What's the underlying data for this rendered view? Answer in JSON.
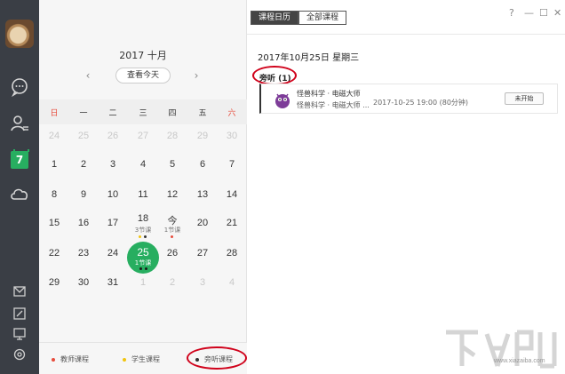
{
  "sidebar": {
    "icons": [
      "avatar",
      "chat-icon",
      "contacts-icon",
      "calendar-icon",
      "cloud-icon",
      "mail-icon",
      "edit-icon",
      "screen-icon",
      "settings-icon"
    ],
    "calendar_badge": "7"
  },
  "calendar": {
    "month_label": "2017 十月",
    "today_button": "查看今天",
    "prev": "‹",
    "next": "›",
    "weekdays": [
      "日",
      "一",
      "二",
      "三",
      "四",
      "五",
      "六"
    ],
    "weeks": [
      [
        "24",
        "25",
        "26",
        "27",
        "28",
        "29",
        "30"
      ],
      [
        "1",
        "2",
        "3",
        "4",
        "5",
        "6",
        "7"
      ],
      [
        "8",
        "9",
        "10",
        "11",
        "12",
        "13",
        "14"
      ],
      [
        "15",
        "16",
        "17",
        "18",
        "今",
        "20",
        "21"
      ],
      [
        "22",
        "23",
        "24",
        "25",
        "26",
        "27",
        "28"
      ],
      [
        "29",
        "30",
        "31",
        "1",
        "2",
        "3",
        "4"
      ]
    ],
    "day18_sub": "3节课",
    "day19_sub": "1节课",
    "today_num": "25",
    "today_sub": "1节课",
    "legend": {
      "teacher": "教师课程",
      "student": "学生课程",
      "audit": "旁听课程"
    },
    "colors": {
      "teacher_dot": "#e74c3c",
      "student_dot": "#f1c40f",
      "audit_dot": "#333333",
      "today": "#27ae60"
    }
  },
  "tabs": [
    "课程日历",
    "全部课程"
  ],
  "window_controls": [
    "?",
    "—",
    "☐",
    "✕"
  ],
  "detail": {
    "date_title": "2017年10月25日  星期三",
    "section_label": "旁听 (1)",
    "course": {
      "name": "怪兽科学 · 电磁大师",
      "sub": "怪兽科学 · 电磁大师 ...",
      "time": "2017-10-25 19:00 (80分钟)",
      "status": "未开始"
    }
  },
  "watermark": {
    "url": "www.xiazaiba.com"
  }
}
